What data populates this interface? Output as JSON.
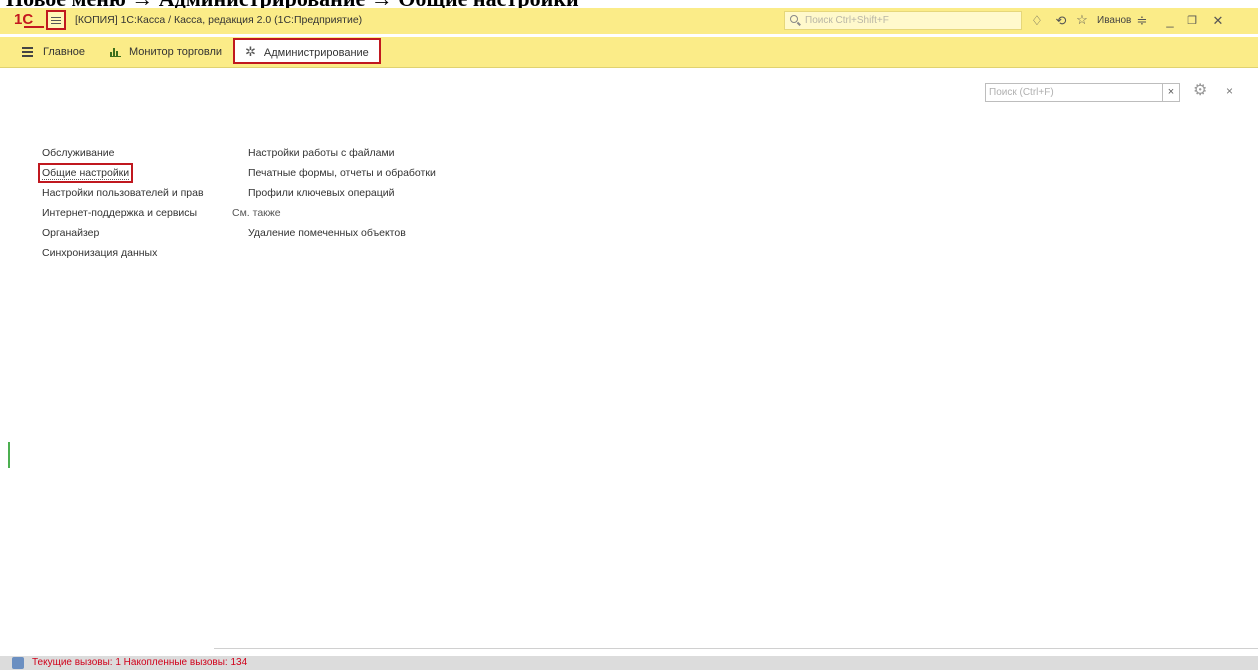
{
  "caption": "Новое меню → Администрирование → Общие настройки",
  "titlebar": {
    "logo": "1С",
    "window_title": "[КОПИЯ] 1С:Касса / Касса, редакция 2.0  (1С:Предприятие)",
    "search_placeholder": "Поиск Ctrl+Shift+F",
    "user": "Иванов",
    "icons": [
      "bell-icon",
      "history-icon",
      "star-icon",
      "settings-menu-icon",
      "minimize-icon",
      "restore-icon",
      "close-icon"
    ]
  },
  "sections": {
    "items": [
      {
        "label": "Главное",
        "icon": "hamburger-icon"
      },
      {
        "label": "Монитор торговли",
        "icon": "bar-chart-icon"
      },
      {
        "label": "Администрирование",
        "icon": "gear-icon",
        "active": true
      }
    ]
  },
  "form_search": {
    "placeholder": "Поиск (Ctrl+F)",
    "clear": "×",
    "close": "×"
  },
  "left_nav": {
    "items": [
      "Обслуживание",
      "Общие настройки",
      "Настройки пользователей и прав",
      "Интернет-поддержка и сервисы",
      "Органайзер",
      "Синхронизация данных"
    ]
  },
  "commands": {
    "items": [
      "Настройки работы с файлами",
      "Печатные формы, отчеты и обработки",
      "Профили ключевых операций"
    ],
    "see_also_label": "См. также",
    "see_also_items": [
      "Удаление помеченных объектов"
    ]
  },
  "status": {
    "text": "Текущие вызовы: 1   Накопленные вызовы: 134"
  },
  "colors": {
    "panel_yellow": "#fbec88",
    "highlight_red": "#c0181f",
    "status_red": "#d0021b"
  }
}
